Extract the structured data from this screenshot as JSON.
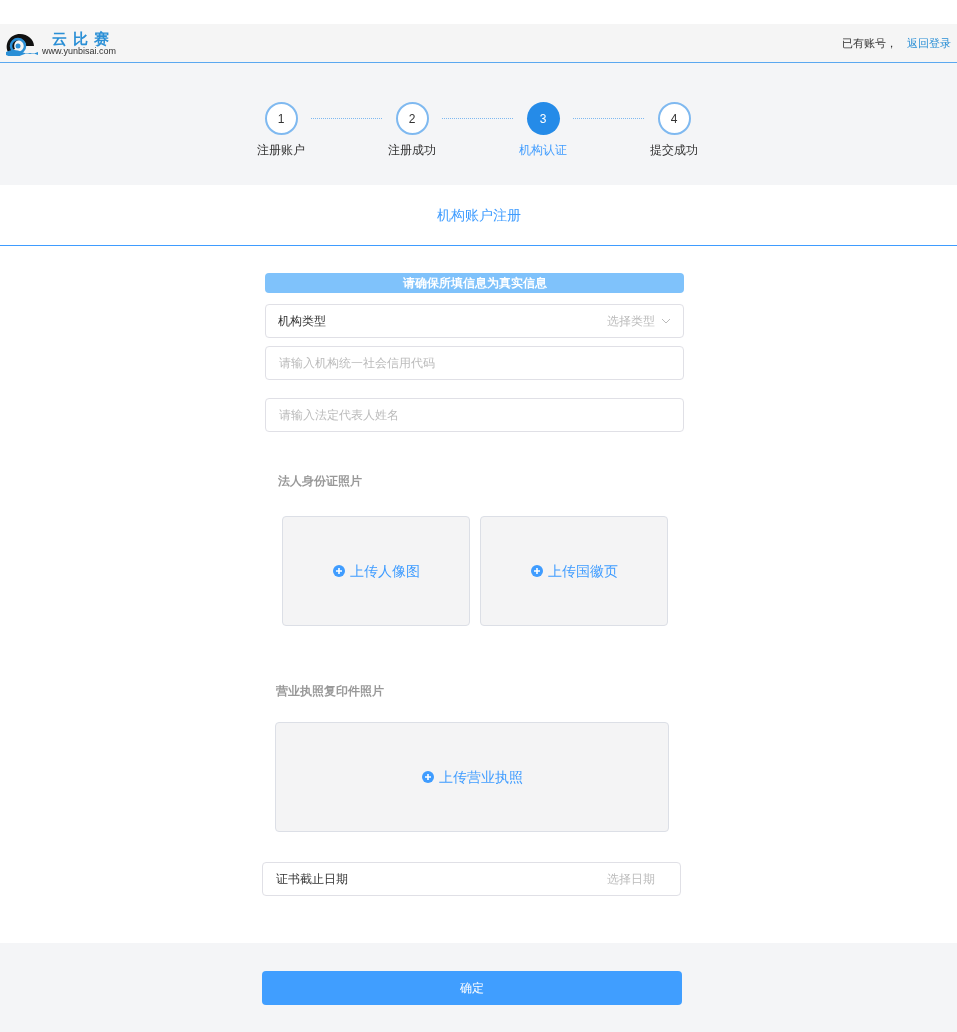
{
  "header": {
    "logo_name": "云比赛",
    "logo_url": "www.yunbisai.com",
    "account_text": "已有账号，",
    "login_link": "返回登录"
  },
  "steps": [
    {
      "number": "1",
      "label": "注册账户",
      "selected": false
    },
    {
      "number": "2",
      "label": "注册成功",
      "selected": false
    },
    {
      "number": "3",
      "label": "机构认证",
      "selected": true
    },
    {
      "number": "4",
      "label": "提交成功",
      "selected": false
    }
  ],
  "form": {
    "title": "机构账户注册",
    "notice": "请确保所填信息为真实信息",
    "type_select": {
      "label": "机构类型",
      "placeholder": "选择类型"
    },
    "credit_code": {
      "placeholder": "请输入机构统一社会信用代码"
    },
    "legal_name": {
      "placeholder": "请输入法定代表人姓名"
    },
    "id_section": {
      "label": "法人身份证照片",
      "uploads": [
        "上传人像图",
        "上传国徽页"
      ]
    },
    "license_section": {
      "label": "营业执照复印件照片",
      "upload": "上传营业执照"
    },
    "expiry": {
      "label": "证书截止日期",
      "placeholder": "选择日期"
    }
  },
  "submit": "确定"
}
